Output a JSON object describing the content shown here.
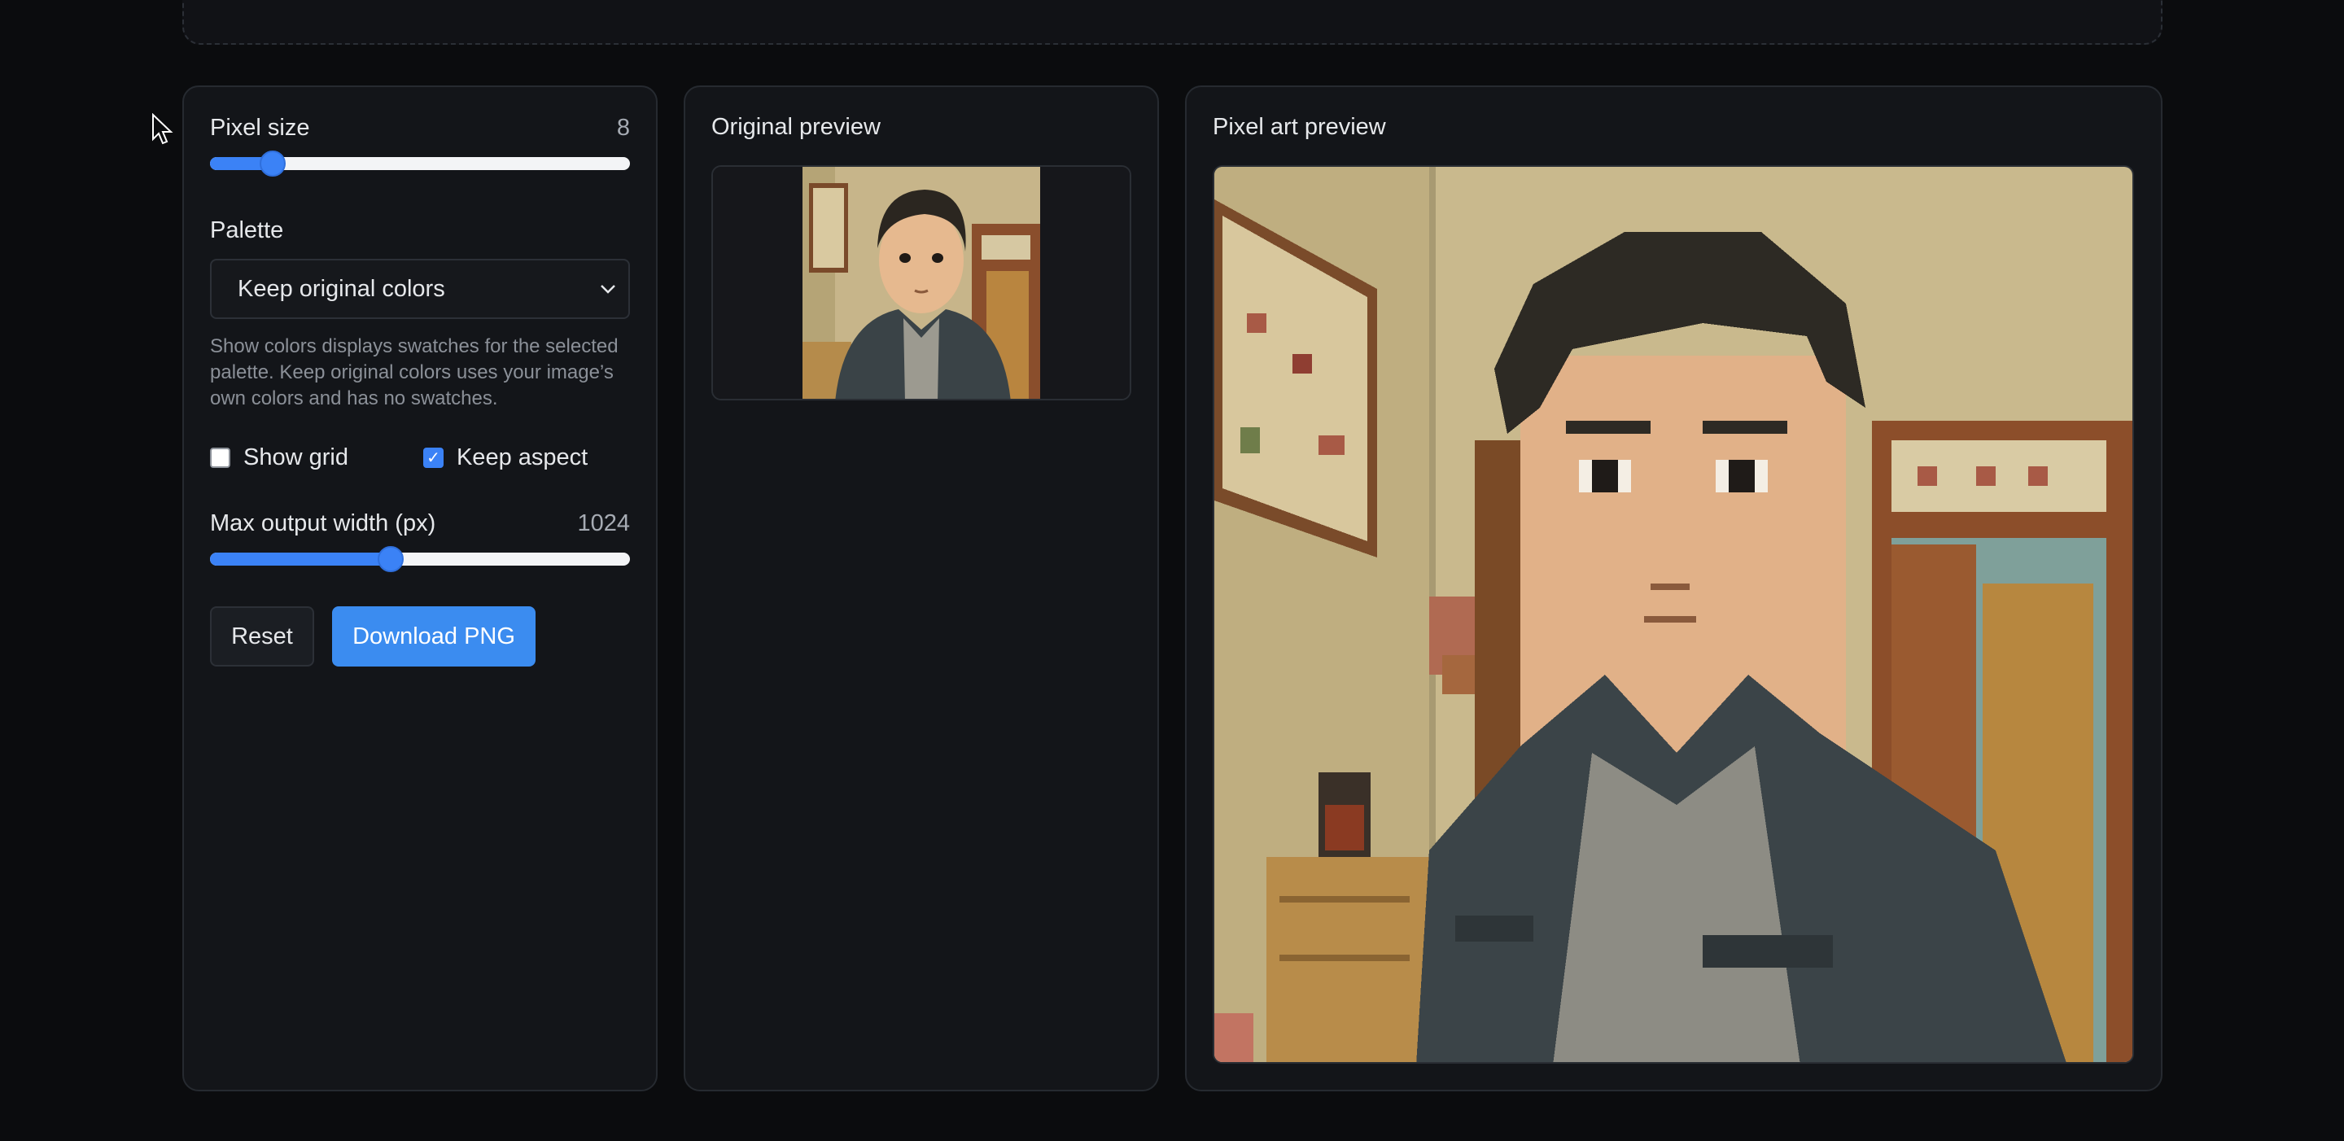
{
  "controls": {
    "pixel_size_label": "Pixel size",
    "pixel_size_value": "8",
    "pixel_size_fraction": 0.15,
    "palette_label": "Palette",
    "palette_selected": "Keep original colors",
    "palette_help": "Show colors displays swatches for the selected palette. Keep original colors uses your image’s own colors and has no swatches.",
    "show_grid_label": "Show grid",
    "show_grid_checked": false,
    "keep_aspect_label": "Keep aspect",
    "keep_aspect_checked": true,
    "max_width_label": "Max output width (px)",
    "max_width_value": "1024",
    "max_width_fraction": 0.43,
    "reset_label": "Reset",
    "download_label": "Download PNG"
  },
  "original": {
    "title": "Original preview"
  },
  "pixelart": {
    "title": "Pixel art preview"
  },
  "colors": {
    "accent": "#3b82f6",
    "panel_bg": "#131519",
    "page_bg": "#0b0c0e"
  }
}
